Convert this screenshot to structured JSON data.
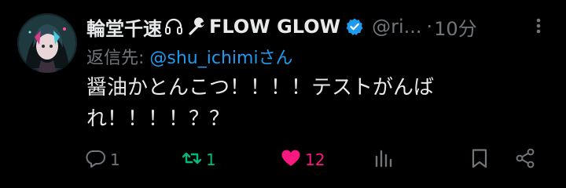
{
  "tweet": {
    "display_name": "輪堂千速",
    "name_suffix": "FLOW GLOW",
    "handle": "@ri...",
    "separator": "·",
    "time": "10分",
    "reply_prefix": "返信先: ",
    "reply_mention": "@shu_ichimiさん",
    "text_line1": "醤油かとんこつ！！！！テストがんば",
    "text_line2": "れ！！！！？？"
  },
  "actions": {
    "reply_count": "1",
    "retweet_count": "1",
    "like_count": "12"
  },
  "icons": {
    "name_icons": [
      "headphones-icon",
      "wrench-icon"
    ],
    "verified": "verified-badge-icon",
    "more": "more-options-icon",
    "reply": "reply-icon",
    "retweet": "retweet-icon",
    "like": "heart-icon",
    "views": "analytics-icon",
    "bookmark": "bookmark-icon",
    "share": "share-icon"
  },
  "colors": {
    "background": "#000000",
    "text": "#e7e9ea",
    "muted": "#71767b",
    "accent": "#1d9bf0",
    "retweet_active": "#00ba7c",
    "like_active": "#f91880"
  }
}
